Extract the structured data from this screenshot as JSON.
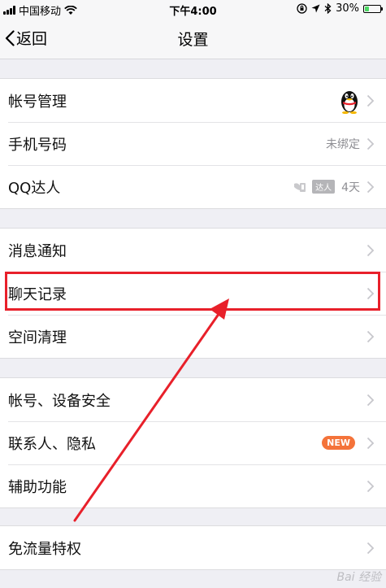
{
  "status_bar": {
    "carrier": "中国移动",
    "time": "下午4:00",
    "battery": "30%",
    "battery_level": 0.3
  },
  "nav": {
    "back_label": "返回",
    "title": "设置"
  },
  "groups": [
    {
      "rows": [
        {
          "label": "帐号管理",
          "value": "",
          "has_avatar": true
        },
        {
          "label": "手机号码",
          "value": "未绑定"
        },
        {
          "label": "QQ达人",
          "value": "4天",
          "badge": "达人"
        }
      ]
    },
    {
      "rows": [
        {
          "label": "消息通知",
          "value": ""
        },
        {
          "label": "聊天记录",
          "value": ""
        },
        {
          "label": "空间清理",
          "value": ""
        }
      ]
    },
    {
      "rows": [
        {
          "label": "帐号、设备安全",
          "value": ""
        },
        {
          "label": "联系人、隐私",
          "value": "",
          "badge": "NEW"
        },
        {
          "label": "辅助功能",
          "value": ""
        }
      ]
    },
    {
      "rows": [
        {
          "label": "免流量特权",
          "value": ""
        }
      ]
    }
  ],
  "annotation": {
    "color": "#e8202a"
  },
  "colors": {
    "background": "#efeff4",
    "new_badge": "#f4733a"
  },
  "watermark": "Bai 经验"
}
